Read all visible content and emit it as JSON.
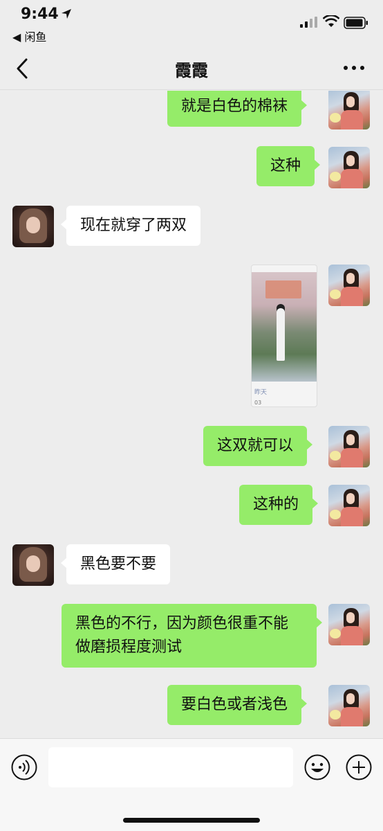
{
  "status_bar": {
    "time": "9:44",
    "back_app": "◀ 闲鱼"
  },
  "nav": {
    "title": "霞霞"
  },
  "messages": [
    {
      "from": "me",
      "text": "就是白色的棉袜"
    },
    {
      "from": "me",
      "text": "这种"
    },
    {
      "from": "her",
      "text": "现在就穿了两双"
    },
    {
      "from": "me",
      "type": "image",
      "caption": "昨天",
      "caption2": "03"
    },
    {
      "from": "me",
      "text": "这双就可以"
    },
    {
      "from": "me",
      "text": "这种的"
    },
    {
      "from": "her",
      "text": "黑色要不要"
    },
    {
      "from": "me",
      "text": "黑色的不行，因为颜色很重不能做磨损程度测试"
    },
    {
      "from": "me",
      "text": "要白色或者浅色"
    }
  ],
  "input": {
    "placeholder": ""
  },
  "colors": {
    "background": "#ededed",
    "my_bubble": "#95ec69",
    "her_bubble": "#ffffff"
  }
}
